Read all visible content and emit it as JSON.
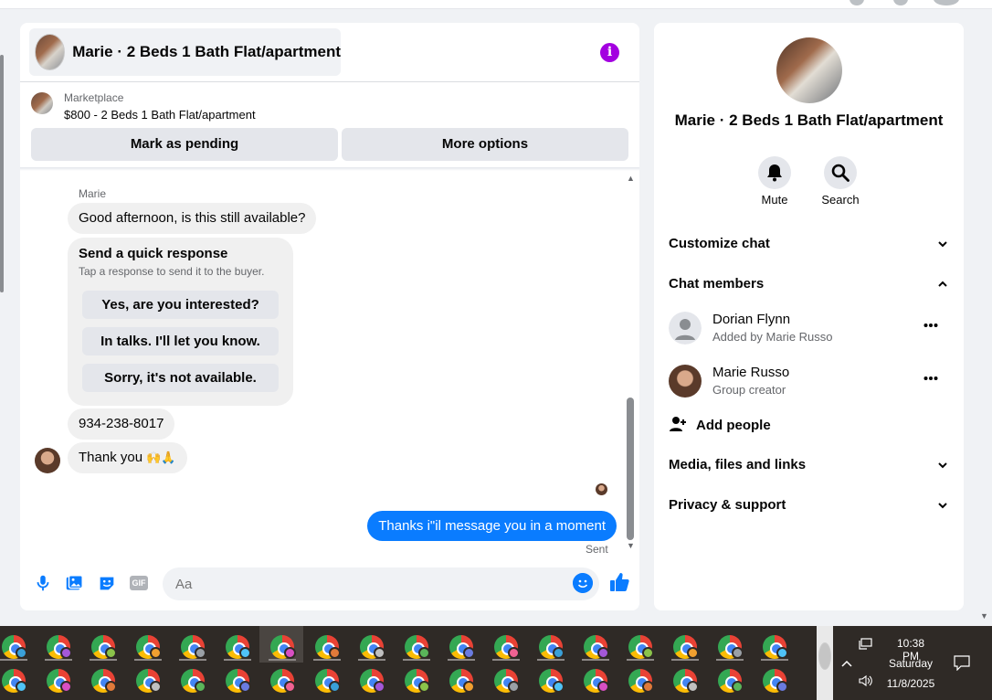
{
  "chat": {
    "title": "Marie · 2 Beds 1 Bath Flat/apartment",
    "marketplace_label": "Marketplace",
    "listing_title": "$800 - 2 Beds 1 Bath Flat/apartment",
    "mark_pending_label": "Mark as pending",
    "more_options_label": "More options",
    "sender_name": "Marie",
    "messages": {
      "incoming_1": "Good afternoon, is this still available?",
      "quick_response_title": "Send a quick response",
      "quick_response_sub": "Tap a response to send it to the buyer.",
      "quick_options": [
        "Yes, are you interested?",
        "In talks. I'll let you know.",
        "Sorry, it's not available."
      ],
      "phone": "934-238-8017",
      "thanks": "Thank you",
      "thanks_emoji": "🙌🙏",
      "outgoing_1": "Thanks i\"il message you in a moment",
      "sent_label": "Sent"
    },
    "composer": {
      "placeholder": "Aa",
      "gif_label": "GIF"
    }
  },
  "side": {
    "title": "Marie · 2 Beds 1 Bath Flat/apartment",
    "mute_label": "Mute",
    "search_label": "Search",
    "customize_label": "Customize chat",
    "members_label": "Chat members",
    "members": [
      {
        "name": "Dorian Flynn",
        "sub": "Added by Marie Russo"
      },
      {
        "name": "Marie Russo",
        "sub": "Group creator"
      }
    ],
    "add_people_label": "Add people",
    "media_label": "Media, files and links",
    "privacy_label": "Privacy & support"
  },
  "taskbar": {
    "time": "10:38 PM",
    "day": "Saturday",
    "date": "11/8/2025"
  },
  "colors": {
    "accent": "#0a7cff",
    "info": "#a300e0"
  }
}
